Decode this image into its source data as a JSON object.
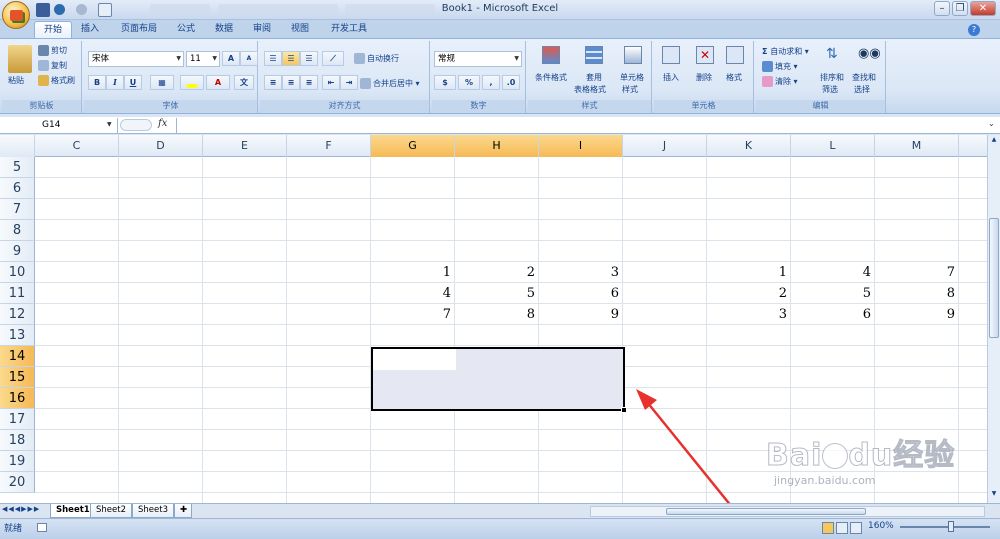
{
  "window": {
    "title": "Book1 - Microsoft Excel"
  },
  "tabs": [
    "开始",
    "插入",
    "页面布局",
    "公式",
    "数据",
    "审阅",
    "视图",
    "开发工具"
  ],
  "ribbon": {
    "clipboard": {
      "label": "剪贴板",
      "paste": "粘贴",
      "cut": "剪切",
      "copy": "复制",
      "format_painter": "格式刷"
    },
    "font": {
      "label": "字体",
      "name": "宋体",
      "size": "11",
      "bold": "B",
      "italic": "I",
      "underline": "U",
      "grow": "A",
      "shrink": "A",
      "color_a": "A"
    },
    "alignment": {
      "label": "对齐方式",
      "wrap": "自动换行",
      "merge": "合并后居中"
    },
    "number": {
      "label": "数字",
      "format": "常规",
      "percent": "%",
      "comma": ","
    },
    "styles": {
      "label": "样式",
      "conditional": "条件格式",
      "table_format_line1": "套用",
      "table_format_line2": "表格格式",
      "cell_style_line1": "单元格",
      "cell_style_line2": "样式"
    },
    "cells": {
      "label": "单元格",
      "insert": "插入",
      "delete": "删除",
      "format": "格式"
    },
    "editing": {
      "label": "编辑",
      "autosum": "自动求和",
      "fill": "填充",
      "clear": "清除",
      "sort_line1": "排序和",
      "sort_line2": "筛选",
      "find_line1": "查找和",
      "find_line2": "选择"
    }
  },
  "formula_bar": {
    "name_box": "G14",
    "fx": "fx",
    "value": ""
  },
  "columns": [
    "C",
    "D",
    "E",
    "F",
    "G",
    "H",
    "I",
    "J",
    "K",
    "L",
    "M"
  ],
  "rows": [
    "5",
    "6",
    "7",
    "8",
    "9",
    "10",
    "11",
    "12",
    "13",
    "14",
    "15",
    "16",
    "17",
    "18",
    "19",
    "20"
  ],
  "cells": [
    {
      "col": "G",
      "row": "10",
      "value": "1"
    },
    {
      "col": "H",
      "row": "10",
      "value": "2"
    },
    {
      "col": "I",
      "row": "10",
      "value": "3"
    },
    {
      "col": "G",
      "row": "11",
      "value": "4"
    },
    {
      "col": "H",
      "row": "11",
      "value": "5"
    },
    {
      "col": "I",
      "row": "11",
      "value": "6"
    },
    {
      "col": "G",
      "row": "12",
      "value": "7"
    },
    {
      "col": "H",
      "row": "12",
      "value": "8"
    },
    {
      "col": "I",
      "row": "12",
      "value": "9"
    },
    {
      "col": "K",
      "row": "10",
      "value": "1"
    },
    {
      "col": "L",
      "row": "10",
      "value": "4"
    },
    {
      "col": "M",
      "row": "10",
      "value": "7"
    },
    {
      "col": "K",
      "row": "11",
      "value": "2"
    },
    {
      "col": "L",
      "row": "11",
      "value": "5"
    },
    {
      "col": "M",
      "row": "11",
      "value": "8"
    },
    {
      "col": "K",
      "row": "12",
      "value": "3"
    },
    {
      "col": "L",
      "row": "12",
      "value": "6"
    },
    {
      "col": "M",
      "row": "12",
      "value": "9"
    }
  ],
  "selected_columns": [
    "G",
    "H",
    "I"
  ],
  "selected_rows": [
    "14",
    "15",
    "16"
  ],
  "sheets": [
    "Sheet1",
    "Sheet2",
    "Sheet3"
  ],
  "active_sheet": "Sheet1",
  "status": {
    "ready": "就绪",
    "zoom": "160%"
  },
  "watermark": {
    "brand": "Bai",
    "brand2": "du",
    "cn": "经验",
    "url": "jingyan.baidu.com"
  },
  "colors": {
    "accent": "#15428b",
    "selected_header": "#f6b956",
    "arrow": "#e8302c"
  }
}
